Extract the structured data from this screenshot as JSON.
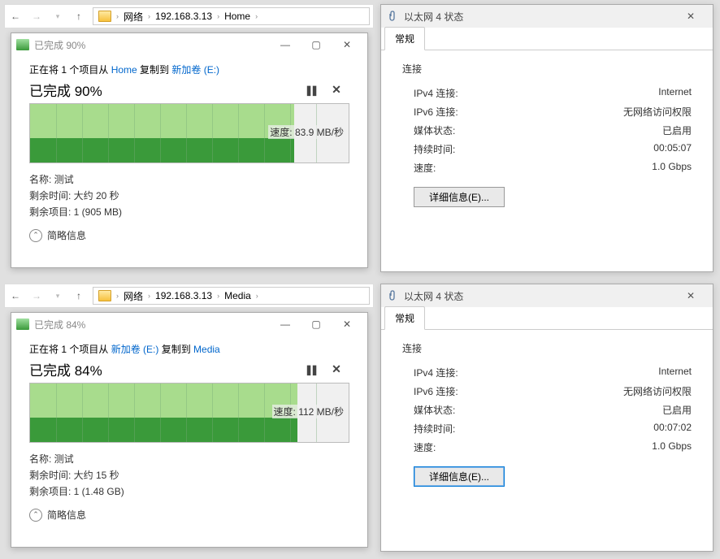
{
  "top": {
    "explorer": {
      "crumbs": [
        "网络",
        "192.168.3.13",
        "Home"
      ]
    },
    "copy": {
      "title": "已完成 90%",
      "desc_pre": "正在将 1 个项目从 ",
      "desc_src": "Home",
      "desc_mid": " 复制到 ",
      "desc_dst": "新加卷 (E:)",
      "pct_text": "已完成 90%",
      "fill_pct": 83,
      "dark_pct": 83,
      "speed_label": "速度: 83.9 MB/秒",
      "name_label": "名称: ",
      "name_value": "测试",
      "remain_time": "剩余时间: 大约 20 秒",
      "remain_items": "剩余项目: 1 (905 MB)",
      "brief": "简略信息"
    },
    "eth": {
      "title": "以太网 4 状态",
      "tab": "常规",
      "sect": "连接",
      "rows": [
        {
          "k": "IPv4 连接:",
          "v": "Internet"
        },
        {
          "k": "IPv6 连接:",
          "v": "无网络访问权限"
        },
        {
          "k": "媒体状态:",
          "v": "已启用"
        },
        {
          "k": "持续时间:",
          "v": "00:05:07"
        },
        {
          "k": "速度:",
          "v": "1.0 Gbps"
        }
      ],
      "detail_btn": "详细信息(E)...",
      "detail_focus": false
    }
  },
  "bottom": {
    "explorer": {
      "crumbs": [
        "网络",
        "192.168.3.13",
        "Media"
      ]
    },
    "copy": {
      "title": "已完成 84%",
      "desc_pre": "正在将 1 个项目从 ",
      "desc_src": "新加卷 (E:)",
      "desc_mid": " 复制到 ",
      "desc_dst": "Media",
      "pct_text": "已完成 84%",
      "fill_pct": 84,
      "dark_pct": 84,
      "speed_label": "速度: 112 MB/秒",
      "name_label": "名称: ",
      "name_value": "测试",
      "remain_time": "剩余时间: 大约 15 秒",
      "remain_items": "剩余项目: 1 (1.48 GB)",
      "brief": "简略信息"
    },
    "eth": {
      "title": "以太网 4 状态",
      "tab": "常规",
      "sect": "连接",
      "rows": [
        {
          "k": "IPv4 连接:",
          "v": "Internet"
        },
        {
          "k": "IPv6 连接:",
          "v": "无网络访问权限"
        },
        {
          "k": "媒体状态:",
          "v": "已启用"
        },
        {
          "k": "持续时间:",
          "v": "00:07:02"
        },
        {
          "k": "速度:",
          "v": "1.0 Gbps"
        }
      ],
      "detail_btn": "详细信息(E)...",
      "detail_focus": true
    }
  }
}
